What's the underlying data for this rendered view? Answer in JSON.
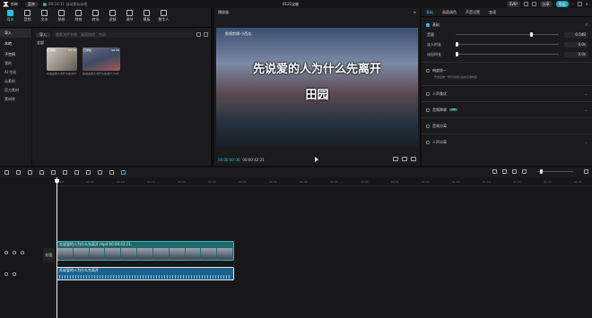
{
  "app": {
    "name": "剪映",
    "menu": "菜单",
    "autosave": "09:16:11 自动保存本地",
    "doc_title": "0121全能",
    "svip": "SVIP",
    "share": "分享",
    "export": "导出"
  },
  "tools": [
    {
      "label": "媒体"
    },
    {
      "label": "音频"
    },
    {
      "label": "文本"
    },
    {
      "label": "贴纸"
    },
    {
      "label": "特效"
    },
    {
      "label": "转场"
    },
    {
      "label": "滤镜"
    },
    {
      "label": "调节"
    },
    {
      "label": "模板"
    },
    {
      "label": "数字人"
    }
  ],
  "sidebar": {
    "items": [
      "本地",
      "导入",
      "我的",
      "AI 生成",
      "云素材",
      "官方素材",
      "素材库"
    ],
    "local_head": "本地",
    "sub_head": "子空间"
  },
  "media": {
    "import": "导入",
    "search_placeholder": "搜索文件名称、画面描述、台词",
    "sub": "全部",
    "items": [
      {
        "name": "问说爱的人为什么先离开.mp4",
        "dur": "07:10",
        "mark": "已添加"
      },
      {
        "name": "先说爱的人为什么先离开.mp4",
        "dur": "00:56",
        "mark": "已添加"
      }
    ]
  },
  "player": {
    "title": "播放器",
    "watermark": "影视剪辑·小西瓜",
    "caption1": "先说爱的人为什么先离开",
    "caption2": "田园",
    "tc_current": "00:00:00:00",
    "tc_total": "00:00:42:21"
  },
  "right": {
    "tabs": [
      "基础",
      "画面调色",
      "声音设置",
      "变速"
    ],
    "basic": "基础",
    "volume_label": "音量",
    "volume_val": "0.0dB",
    "fadein_label": "淡入时长",
    "fadein_val": "0.0s",
    "fadeout_label": "淡出时长",
    "fadeout_val": "0.0s",
    "loudness_label": "响度统一",
    "loudness_desc": "开启后统一所有音频片段的基准响度",
    "voice_enhance": "人声美化",
    "noise_reduce": "音频降噪",
    "noise_tag": "VIP",
    "voice_sep": "音频分离",
    "voice_restore": "人声分离"
  },
  "timeline": {
    "ticks": [
      "00:00",
      "00:05",
      "00:10",
      "00:15",
      "00:20",
      "00:25",
      "00:30",
      "00:35",
      "00:40",
      "00:45",
      "00:50",
      "00:55",
      "01:00",
      "01:05",
      "01:10",
      "01:15",
      "01:20",
      "01:25"
    ],
    "cover": "封面",
    "video_clip_name": "先说爱的人为什么先离开.mp4",
    "video_clip_dur": "00:00:42:21",
    "audio_clip_name": "先说爱的人为什么先离开",
    "zoom_label": "缩放"
  }
}
